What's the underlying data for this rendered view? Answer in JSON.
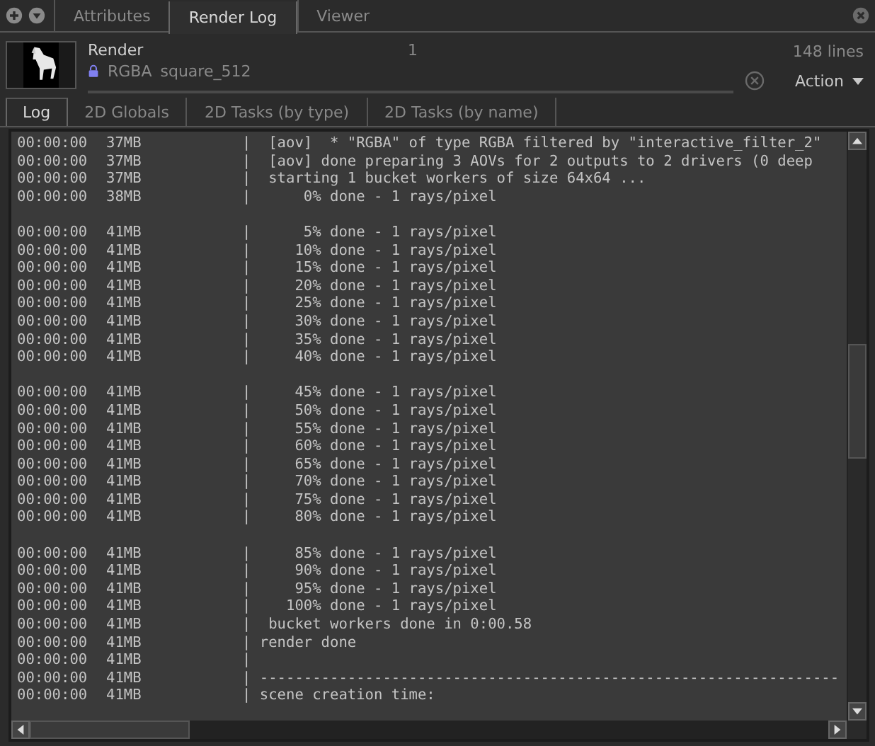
{
  "top_tabs": [
    {
      "label": "Attributes",
      "selected": false
    },
    {
      "label": "Render Log",
      "selected": true
    },
    {
      "label": "Viewer",
      "selected": false
    }
  ],
  "render": {
    "title": "Render",
    "channel": "RGBA",
    "image": "square_512",
    "frame": "1",
    "line_count": "148 lines",
    "locked": true,
    "menu": "Action"
  },
  "sub_tabs": [
    {
      "label": "Log",
      "selected": true
    },
    {
      "label": "2D Globals",
      "selected": false
    },
    {
      "label": "2D Tasks (by type)",
      "selected": false
    },
    {
      "label": "2D Tasks (by name)",
      "selected": false
    }
  ],
  "log": [
    {
      "kind": "entry",
      "time": "00:00:00",
      "memory": "37MB",
      "message": "|  [aov]  * \"RGBA\" of type RGBA filtered by \"interactive_filter_2\""
    },
    {
      "kind": "entry",
      "time": "00:00:00",
      "memory": "37MB",
      "message": "|  [aov] done preparing 3 AOVs for 2 outputs to 2 drivers (0 deep"
    },
    {
      "kind": "entry",
      "time": "00:00:00",
      "memory": "37MB",
      "message": "|  starting 1 bucket workers of size 64x64 ..."
    },
    {
      "kind": "entry",
      "time": "00:00:00",
      "memory": "38MB",
      "message": "|      0% done - 1 rays/pixel"
    },
    {
      "kind": "blank"
    },
    {
      "kind": "entry",
      "time": "00:00:00",
      "memory": "41MB",
      "message": "|      5% done - 1 rays/pixel"
    },
    {
      "kind": "entry",
      "time": "00:00:00",
      "memory": "41MB",
      "message": "|     10% done - 1 rays/pixel"
    },
    {
      "kind": "entry",
      "time": "00:00:00",
      "memory": "41MB",
      "message": "|     15% done - 1 rays/pixel"
    },
    {
      "kind": "entry",
      "time": "00:00:00",
      "memory": "41MB",
      "message": "|     20% done - 1 rays/pixel"
    },
    {
      "kind": "entry",
      "time": "00:00:00",
      "memory": "41MB",
      "message": "|     25% done - 1 rays/pixel"
    },
    {
      "kind": "entry",
      "time": "00:00:00",
      "memory": "41MB",
      "message": "|     30% done - 1 rays/pixel"
    },
    {
      "kind": "entry",
      "time": "00:00:00",
      "memory": "41MB",
      "message": "|     35% done - 1 rays/pixel"
    },
    {
      "kind": "entry",
      "time": "00:00:00",
      "memory": "41MB",
      "message": "|     40% done - 1 rays/pixel"
    },
    {
      "kind": "blank"
    },
    {
      "kind": "entry",
      "time": "00:00:00",
      "memory": "41MB",
      "message": "|     45% done - 1 rays/pixel"
    },
    {
      "kind": "entry",
      "time": "00:00:00",
      "memory": "41MB",
      "message": "|     50% done - 1 rays/pixel"
    },
    {
      "kind": "entry",
      "time": "00:00:00",
      "memory": "41MB",
      "message": "|     55% done - 1 rays/pixel"
    },
    {
      "kind": "entry",
      "time": "00:00:00",
      "memory": "41MB",
      "message": "|     60% done - 1 rays/pixel"
    },
    {
      "kind": "entry",
      "time": "00:00:00",
      "memory": "41MB",
      "message": "|     65% done - 1 rays/pixel"
    },
    {
      "kind": "entry",
      "time": "00:00:00",
      "memory": "41MB",
      "message": "|     70% done - 1 rays/pixel"
    },
    {
      "kind": "entry",
      "time": "00:00:00",
      "memory": "41MB",
      "message": "|     75% done - 1 rays/pixel"
    },
    {
      "kind": "entry",
      "time": "00:00:00",
      "memory": "41MB",
      "message": "|     80% done - 1 rays/pixel"
    },
    {
      "kind": "blank"
    },
    {
      "kind": "entry",
      "time": "00:00:00",
      "memory": "41MB",
      "message": "|     85% done - 1 rays/pixel"
    },
    {
      "kind": "entry",
      "time": "00:00:00",
      "memory": "41MB",
      "message": "|     90% done - 1 rays/pixel"
    },
    {
      "kind": "entry",
      "time": "00:00:00",
      "memory": "41MB",
      "message": "|     95% done - 1 rays/pixel"
    },
    {
      "kind": "entry",
      "time": "00:00:00",
      "memory": "41MB",
      "message": "|    100% done - 1 rays/pixel"
    },
    {
      "kind": "entry",
      "time": "00:00:00",
      "memory": "41MB",
      "message": "|  bucket workers done in 0:00.58"
    },
    {
      "kind": "entry",
      "time": "00:00:00",
      "memory": "41MB",
      "message": "| render done"
    },
    {
      "kind": "entry",
      "time": "00:00:00",
      "memory": "41MB",
      "message": "|"
    },
    {
      "kind": "entry",
      "time": "00:00:00",
      "memory": "41MB",
      "message": "| ------------------------------------------------------------------"
    },
    {
      "kind": "entry",
      "time": "00:00:00",
      "memory": "41MB",
      "message": "| scene creation time:"
    }
  ]
}
